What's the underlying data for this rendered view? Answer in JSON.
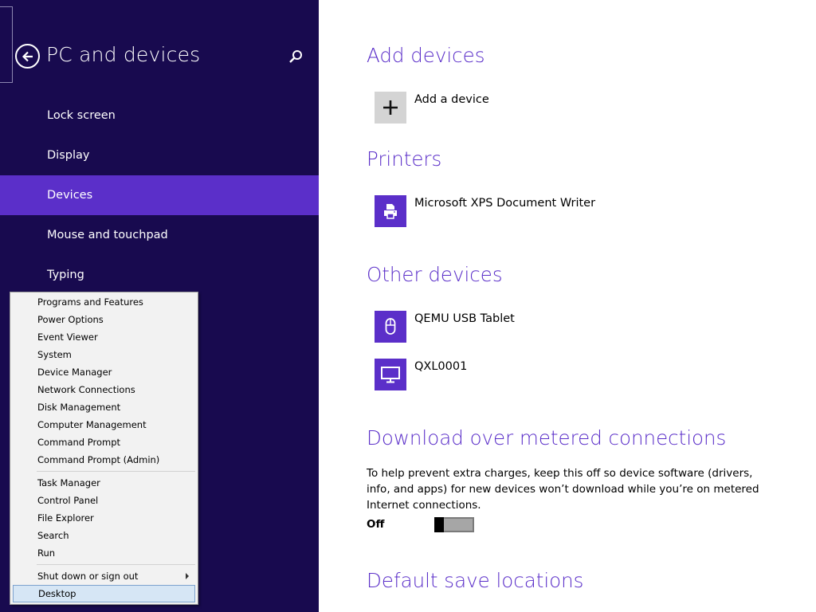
{
  "left_pane": {
    "title": "PC and devices",
    "nav_items": [
      {
        "label": "Lock screen",
        "selected": false
      },
      {
        "label": "Display",
        "selected": false
      },
      {
        "label": "Devices",
        "selected": true
      },
      {
        "label": "Mouse and touchpad",
        "selected": false
      },
      {
        "label": "Typing",
        "selected": false
      }
    ],
    "icons": {
      "back": "back-arrow-icon",
      "search": "search-icon"
    }
  },
  "content": {
    "add_devices": {
      "heading": "Add devices",
      "add_label": "Add a device",
      "icon": "plus-icon"
    },
    "printers": {
      "heading": "Printers",
      "items": [
        {
          "label": "Microsoft XPS Document Writer",
          "icon": "printer-icon"
        }
      ]
    },
    "other_devices": {
      "heading": "Other devices",
      "items": [
        {
          "label": "QEMU USB Tablet",
          "icon": "mouse-icon"
        },
        {
          "label": "QXL0001",
          "icon": "monitor-icon"
        }
      ]
    },
    "metered": {
      "heading": "Download over metered connections",
      "description": "To help prevent extra charges, keep this off so device software (drivers, info, and apps) for new devices won’t download while you’re on metered Internet connections.",
      "toggle_label": "Off",
      "toggle_on": false
    },
    "save_locations": {
      "heading": "Default save locations"
    }
  },
  "context_menu": {
    "groups": [
      [
        "Programs and Features",
        "Power Options",
        "Event Viewer",
        "System",
        "Device Manager",
        "Network Connections",
        "Disk Management",
        "Computer Management",
        "Command Prompt",
        "Command Prompt (Admin)"
      ],
      [
        "Task Manager",
        "Control Panel",
        "File Explorer",
        "Search",
        "Run"
      ],
      [
        "Shut down or sign out",
        "Desktop"
      ]
    ],
    "highlighted": "Desktop",
    "has_submenu": "Shut down or sign out"
  },
  "colors": {
    "left_pane_bg": "#180a4f",
    "accent": "#5b2fc9",
    "content_bg": "#ffffff",
    "menu_bg": "#f2f2f2",
    "menu_highlight": "#d6e6f5"
  }
}
